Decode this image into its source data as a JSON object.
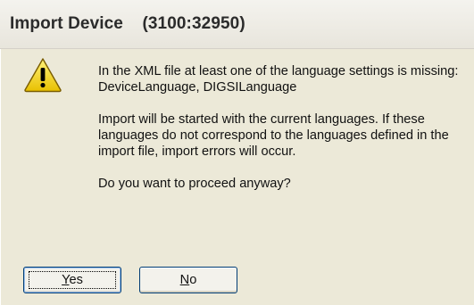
{
  "window": {
    "title": "Import Device    (3100:32950)"
  },
  "icon": {
    "name": "warning-icon",
    "color": "#f5d000"
  },
  "message": {
    "line1": "In the XML file at least one of the language settings is missing: DeviceLanguage, DIGSILanguage",
    "line2": "Import will be started with the current languages. If these languages do not correspond to the languages defined in the import file, import errors will occur.",
    "line3": "Do you want to proceed anyway?"
  },
  "buttons": {
    "yes_label": "Yes",
    "no_label": "No"
  }
}
